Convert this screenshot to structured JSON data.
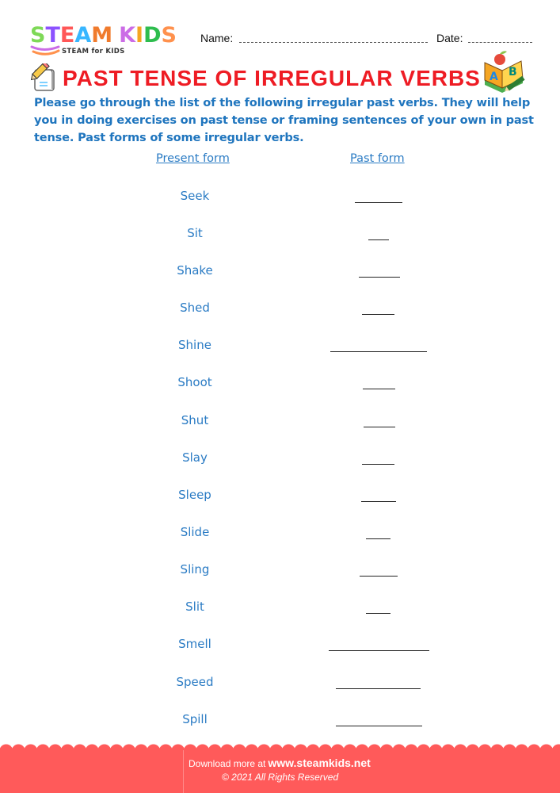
{
  "header": {
    "logo": {
      "letters": [
        {
          "char": "S",
          "color": "#7ed957"
        },
        {
          "char": "T",
          "color": "#8c52ff"
        },
        {
          "char": "E",
          "color": "#ff5757"
        },
        {
          "char": "A",
          "color": "#38b6ff"
        },
        {
          "char": "M",
          "color": "#f07b2d"
        },
        {
          "char": " ",
          "color": "#ffffff"
        },
        {
          "char": "K",
          "color": "#cb6ce6"
        },
        {
          "char": "I",
          "color": "#f5a623"
        },
        {
          "char": "D",
          "color": "#2ebd4e"
        },
        {
          "char": "S",
          "color": "#ff914d"
        }
      ],
      "subtitle": "STEAM for KIDS"
    },
    "name_label": "Name:",
    "date_label": "Date:"
  },
  "title": {
    "text": "PAST TENSE OF IRREGULAR VERBS",
    "color": "#ee1c24",
    "left_icon": "pencil-paper-icon",
    "right_icon": "abc-book-icon"
  },
  "intro": "Please go through the list of the following irregular past verbs. They will help you in doing exercises on past tense or framing sentences of your own in past tense. Past forms of some irregular verbs.",
  "table": {
    "headers": {
      "present": "Present form",
      "past": "Past form"
    },
    "rows": [
      {
        "present": "Seek",
        "past": ""
      },
      {
        "present": "Sit",
        "past": ""
      },
      {
        "present": "Shake",
        "past": ""
      },
      {
        "present": "Shed",
        "past": ""
      },
      {
        "present": "Shine",
        "past": ""
      },
      {
        "present": "Shoot",
        "past": ""
      },
      {
        "present": "Shut",
        "past": ""
      },
      {
        "present": "Slay",
        "past": ""
      },
      {
        "present": "Sleep",
        "past": ""
      },
      {
        "present": "Slide",
        "past": ""
      },
      {
        "present": "Sling",
        "past": ""
      },
      {
        "present": "Slit",
        "past": ""
      },
      {
        "present": "Smell",
        "past": ""
      },
      {
        "present": "Speed",
        "past": ""
      },
      {
        "present": "Spill",
        "past": ""
      }
    ]
  },
  "footer": {
    "download_prefix": "Download more at",
    "site": "www.steamkids.net",
    "copyright": "© 2021 All Rights Reserved",
    "color": "#ff5a5a"
  }
}
